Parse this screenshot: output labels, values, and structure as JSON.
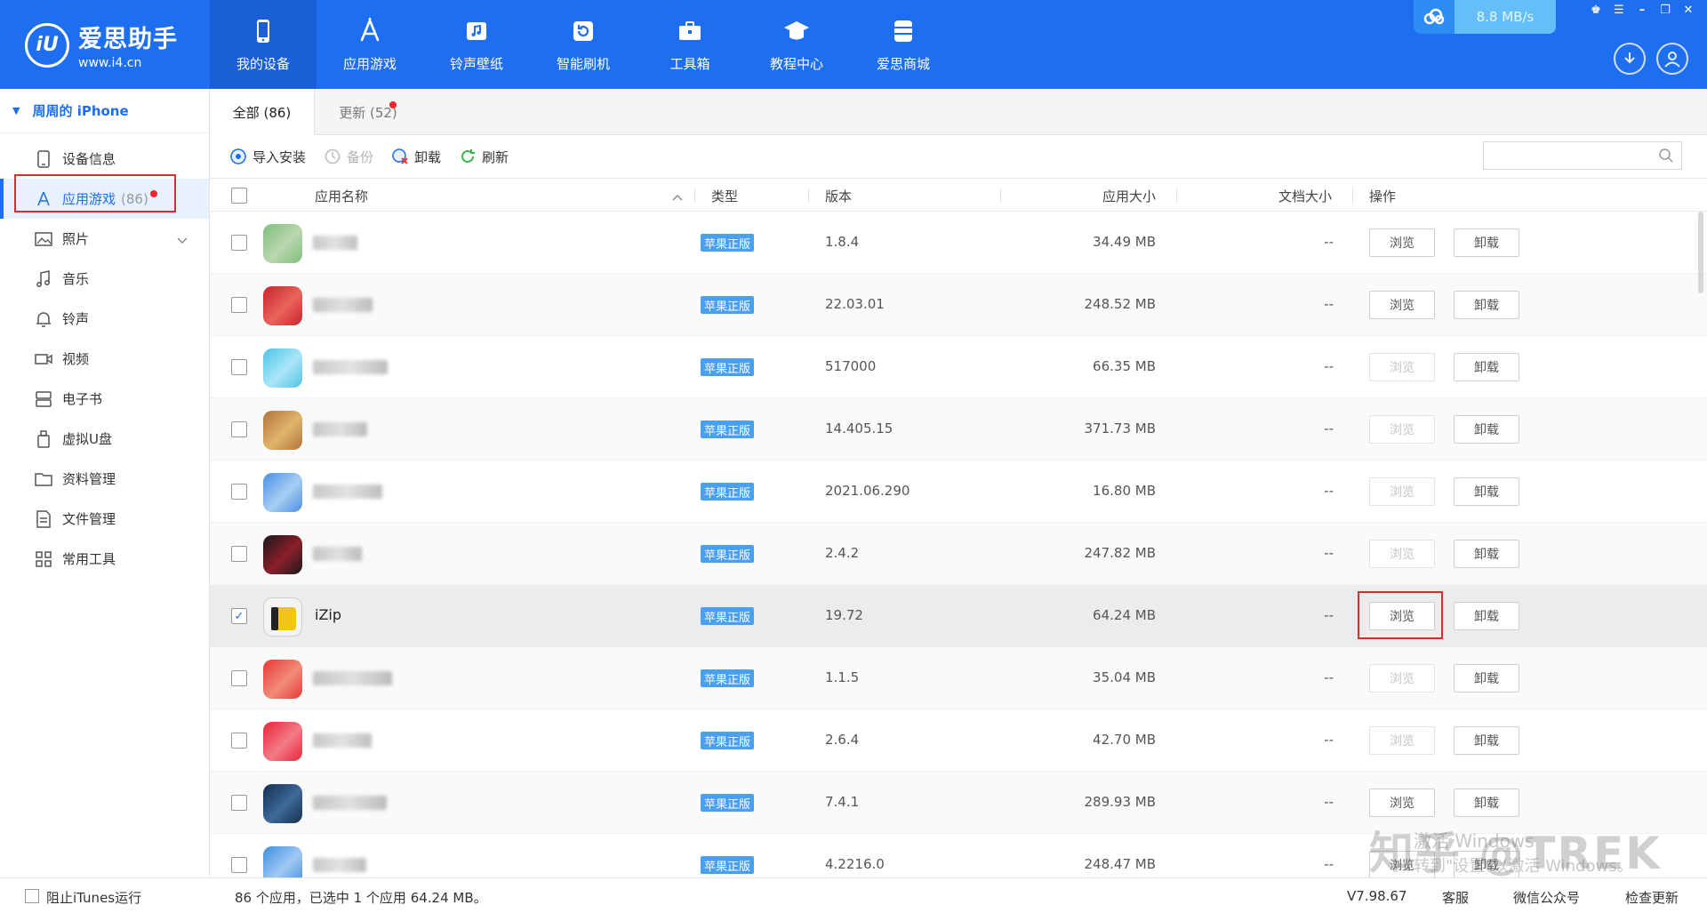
{
  "app": {
    "name": "爱思助手",
    "url": "www.i4.cn",
    "logo_mark": "iU"
  },
  "nav": [
    {
      "label": "我的设备",
      "icon": "phone-icon",
      "active": true
    },
    {
      "label": "应用游戏",
      "icon": "app-store-icon",
      "active": false
    },
    {
      "label": "铃声壁纸",
      "icon": "music-note-icon",
      "active": false
    },
    {
      "label": "智能刷机",
      "icon": "refresh-box-icon",
      "active": false
    },
    {
      "label": "工具箱",
      "icon": "toolbox-icon",
      "active": false
    },
    {
      "label": "教程中心",
      "icon": "graduation-cap-icon",
      "active": false
    },
    {
      "label": "爱思商城",
      "icon": "store-icon",
      "active": false
    }
  ],
  "speed": "8.8 MB/s",
  "sidebar": {
    "device": "周周的 iPhone",
    "items": [
      {
        "label": "设备信息",
        "icon": "phone-info-icon"
      },
      {
        "label": "应用游戏",
        "icon": "app-store-icon",
        "count": "(86)",
        "active": true
      },
      {
        "label": "照片",
        "icon": "photo-icon",
        "expandable": true
      },
      {
        "label": "音乐",
        "icon": "music-icon"
      },
      {
        "label": "铃声",
        "icon": "bell-icon"
      },
      {
        "label": "视频",
        "icon": "video-icon"
      },
      {
        "label": "电子书",
        "icon": "ebook-icon"
      },
      {
        "label": "虚拟U盘",
        "icon": "usb-drive-icon"
      },
      {
        "label": "资料管理",
        "icon": "folder-icon"
      },
      {
        "label": "文件管理",
        "icon": "file-icon"
      },
      {
        "label": "常用工具",
        "icon": "grid-icon"
      }
    ]
  },
  "tabs": [
    {
      "label": "全部 (86)",
      "active": true
    },
    {
      "label": "更新 (52)",
      "active": false,
      "dot": true
    }
  ],
  "toolbar": {
    "import": "导入安装",
    "backup": "备份",
    "uninstall": "卸载",
    "refresh": "刷新"
  },
  "columns": {
    "name": "应用名称",
    "type": "类型",
    "version": "版本",
    "app_size": "应用大小",
    "doc_size": "文档大小",
    "action": "操作"
  },
  "button_labels": {
    "browse": "浏览",
    "uninstall": "卸载"
  },
  "rows": [
    {
      "name": "",
      "type": "苹果正版",
      "version": "1.8.4",
      "size": "34.49 MB",
      "doc": "--",
      "browse_enabled": true,
      "checked": false,
      "c1": "#7fbf7a",
      "c2": "#b9d7b1"
    },
    {
      "name": "",
      "type": "苹果正版",
      "version": "22.03.01",
      "size": "248.52 MB",
      "doc": "--",
      "browse_enabled": true,
      "checked": false,
      "c1": "#c8232c",
      "c2": "#e9645b"
    },
    {
      "name": "",
      "type": "苹果正版",
      "version": "517000",
      "size": "66.35 MB",
      "doc": "--",
      "browse_enabled": false,
      "checked": false,
      "c1": "#4fc3e8",
      "c2": "#a9e6f6"
    },
    {
      "name": "",
      "type": "苹果正版",
      "version": "14.405.15",
      "size": "371.73 MB",
      "doc": "--",
      "browse_enabled": false,
      "checked": false,
      "c1": "#b0743a",
      "c2": "#e0b46a"
    },
    {
      "name": "",
      "type": "苹果正版",
      "version": "2021.06.290",
      "size": "16.80 MB",
      "doc": "--",
      "browse_enabled": false,
      "checked": false,
      "c1": "#4a90e2",
      "c2": "#a6cdf3"
    },
    {
      "name": "",
      "type": "苹果正版",
      "version": "2.4.2",
      "size": "247.82 MB",
      "doc": "--",
      "browse_enabled": false,
      "checked": false,
      "c1": "#1a1a1a",
      "c2": "#8a1f2a"
    },
    {
      "name": "iZip",
      "type": "苹果正版",
      "version": "19.72",
      "size": "64.24 MB",
      "doc": "--",
      "browse_enabled": true,
      "checked": true,
      "selected": true,
      "c1": "#f2c416",
      "c2": "#6e6e6e"
    },
    {
      "name": "",
      "type": "苹果正版",
      "version": "1.1.5",
      "size": "35.04 MB",
      "doc": "--",
      "browse_enabled": false,
      "checked": false,
      "c1": "#e53935",
      "c2": "#f28b7a"
    },
    {
      "name": "",
      "type": "苹果正版",
      "version": "2.6.4",
      "size": "42.70 MB",
      "doc": "--",
      "browse_enabled": false,
      "checked": false,
      "c1": "#e8263a",
      "c2": "#f37a86"
    },
    {
      "name": "",
      "type": "苹果正版",
      "version": "7.4.1",
      "size": "289.93 MB",
      "doc": "--",
      "browse_enabled": true,
      "checked": false,
      "c1": "#14304f",
      "c2": "#3d6a99"
    },
    {
      "name": "",
      "type": "苹果正版",
      "version": "4.2216.0",
      "size": "248.47 MB",
      "doc": "--",
      "browse_enabled": true,
      "checked": false,
      "c1": "#3d8fe0",
      "c2": "#a0c9f2"
    }
  ],
  "statusbar": {
    "block_itunes": "阻止iTunes运行",
    "summary": "86 个应用，已选中 1 个应用 64.24 MB。",
    "version": "V7.98.67",
    "support": "客服",
    "wechat": "微信公众号",
    "check_update": "检查更新"
  },
  "watermark": {
    "brand": "知乎 @TREK",
    "line1": "激活 Windows",
    "line2": "转到\"设置\"以激活 Windows。"
  },
  "colors": {
    "brand": "#1e6ff0",
    "badge": "#4aa0f0",
    "alert": "#f0262b",
    "highlight": "#d32f2f"
  }
}
